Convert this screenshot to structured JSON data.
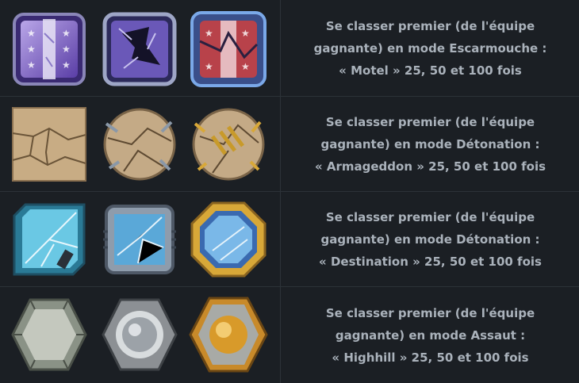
{
  "rows": [
    {
      "name": "row-escarmouche-motel",
      "icons": [
        "motel-bronze-badge-icon",
        "motel-silver-badge-icon",
        "motel-gold-badge-icon"
      ],
      "line1": "Se classer premier (de l'équipe",
      "line2": "gagnante) en mode Escarmouche :",
      "line3": "« Motel » 25, 50 et 100 fois"
    },
    {
      "name": "row-detonation-armageddon",
      "icons": [
        "armageddon-bronze-badge-icon",
        "armageddon-silver-badge-icon",
        "armageddon-gold-badge-icon"
      ],
      "line1": "Se classer premier (de l'équipe",
      "line2": "gagnante) en mode Détonation :",
      "line3": "« Armageddon » 25, 50 et 100 fois"
    },
    {
      "name": "row-detonation-destination",
      "icons": [
        "destination-bronze-badge-icon",
        "destination-silver-badge-icon",
        "destination-gold-badge-icon"
      ],
      "line1": "Se classer premier (de l'équipe",
      "line2": "gagnante) en mode Détonation :",
      "line3": "« Destination » 25, 50 et 100 fois"
    },
    {
      "name": "row-assaut-highhill",
      "icons": [
        "highhill-bronze-badge-icon",
        "highhill-silver-badge-icon",
        "highhill-gold-badge-icon"
      ],
      "line1": "Se classer premier (de l'équipe",
      "line2": "gagnante) en mode Assaut :",
      "line3": "« Highhill » 25, 50 et 100 fois"
    }
  ]
}
